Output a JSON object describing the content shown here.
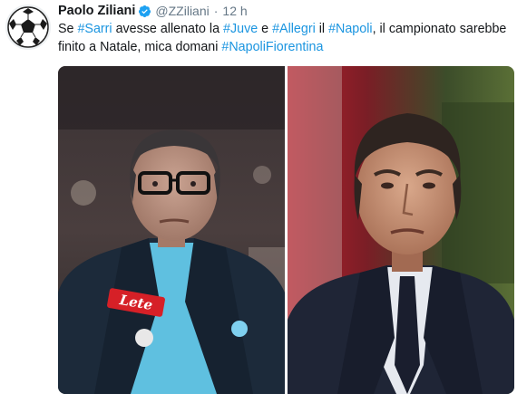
{
  "tweet": {
    "author_name": "Paolo Ziliani",
    "handle": "@ZZiliani",
    "separator": "·",
    "time": "12 h",
    "text_parts": {
      "p1": "Se ",
      "h1": "#Sarri",
      "p2": " avesse allenato la ",
      "h2": "#Juve",
      "p3": " e ",
      "h3": "#Allegri",
      "p4": " il ",
      "h4": "#Napoli",
      "p5": ", il campionato sarebbe finito a Natale, mica domani ",
      "h5": "#NapoliFiorentina"
    },
    "media": {
      "left_photo_badge": "Lete"
    }
  },
  "colors": {
    "hashtag": "#1b95e0",
    "verified": "#1da1f2",
    "muted_text": "#657786"
  },
  "icons": {
    "avatar": "soccer-ball-icon",
    "verified": "verified-badge-icon"
  }
}
